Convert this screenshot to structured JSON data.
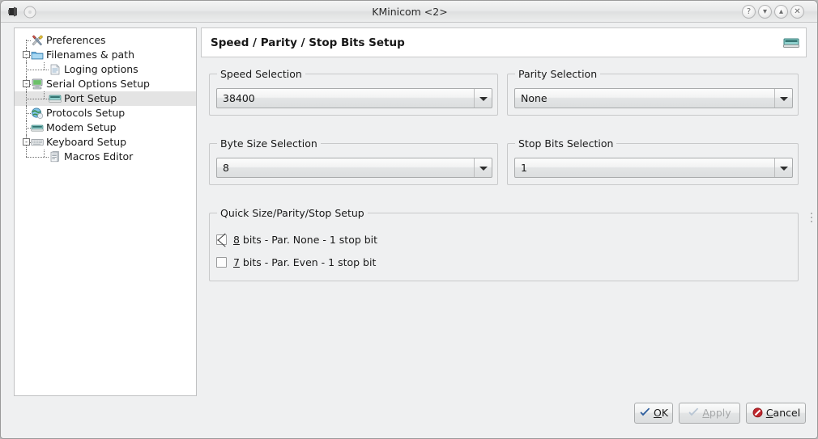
{
  "window": {
    "title": "KMinicom <2>",
    "app_icon": "terminal-icon",
    "menu_icon": "window-menu-icon",
    "buttons": [
      {
        "name": "help-button",
        "glyph": "?"
      },
      {
        "name": "minimize-button",
        "glyph": "▾"
      },
      {
        "name": "maximize-button",
        "glyph": "▴"
      },
      {
        "name": "close-button",
        "glyph": "✕"
      }
    ]
  },
  "sidebar": {
    "items": [
      {
        "label": "Preferences",
        "icon": "tools-icon",
        "indent": 0,
        "expander": "",
        "selected": false
      },
      {
        "label": "Filenames & path",
        "icon": "folder-icon",
        "indent": 0,
        "expander": "-",
        "selected": false
      },
      {
        "label": "Loging options",
        "icon": "log-file-icon",
        "indent": 1,
        "expander": "",
        "selected": false
      },
      {
        "label": "Serial Options Setup",
        "icon": "computer-icon",
        "indent": 0,
        "expander": "-",
        "selected": false
      },
      {
        "label": "Port Setup",
        "icon": "serial-port-icon",
        "indent": 1,
        "expander": "",
        "selected": true
      },
      {
        "label": "Protocols Setup",
        "icon": "globe-icon",
        "indent": 0,
        "expander": "",
        "selected": false
      },
      {
        "label": "Modem Setup",
        "icon": "modem-icon",
        "indent": 0,
        "expander": "",
        "selected": false
      },
      {
        "label": "Keyboard Setup",
        "icon": "keyboard-icon",
        "indent": 0,
        "expander": "-",
        "selected": false
      },
      {
        "label": "Macros Editor",
        "icon": "macros-icon",
        "indent": 1,
        "expander": "",
        "selected": false
      }
    ]
  },
  "page": {
    "header_title": "Speed / Parity / Stop Bits Setup",
    "header_icon": "serial-port-icon",
    "groups": {
      "speed": {
        "title": "Speed Selection",
        "value": "38400"
      },
      "parity": {
        "title": "Parity Selection",
        "value": "None"
      },
      "bytesize": {
        "title": "Byte Size Selection",
        "value": "8"
      },
      "stopbits": {
        "title": "Stop Bits Selection",
        "value": "1"
      }
    },
    "quick": {
      "title": "Quick Size/Parity/Stop Setup",
      "options": [
        {
          "accel": "8",
          "rest": " bits - Par. None - 1 stop bit",
          "checked": true
        },
        {
          "accel": "7",
          "rest": " bits - Par. Even - 1 stop bit",
          "checked": false
        }
      ]
    }
  },
  "footer": {
    "buttons": [
      {
        "name": "ok-button",
        "accel": "O",
        "pre": "",
        "post": "K",
        "icon": "check-icon",
        "disabled": false
      },
      {
        "name": "apply-button",
        "accel": "A",
        "pre": "",
        "post": "pply",
        "icon": "check-icon",
        "disabled": true
      },
      {
        "name": "cancel-button",
        "accel": "C",
        "pre": "",
        "post": "ancel",
        "icon": "cancel-icon",
        "disabled": false
      }
    ]
  },
  "colors": {
    "window_bg": "#eff0f1",
    "panel_bg": "#ffffff",
    "selection": "#e4e4e4",
    "border": "#c8c9ca",
    "text": "#1a1a1a",
    "accent_teal": "#3aa9a4",
    "cancel_red": "#c0272d",
    "ok_blue": "#2f5f9e"
  }
}
